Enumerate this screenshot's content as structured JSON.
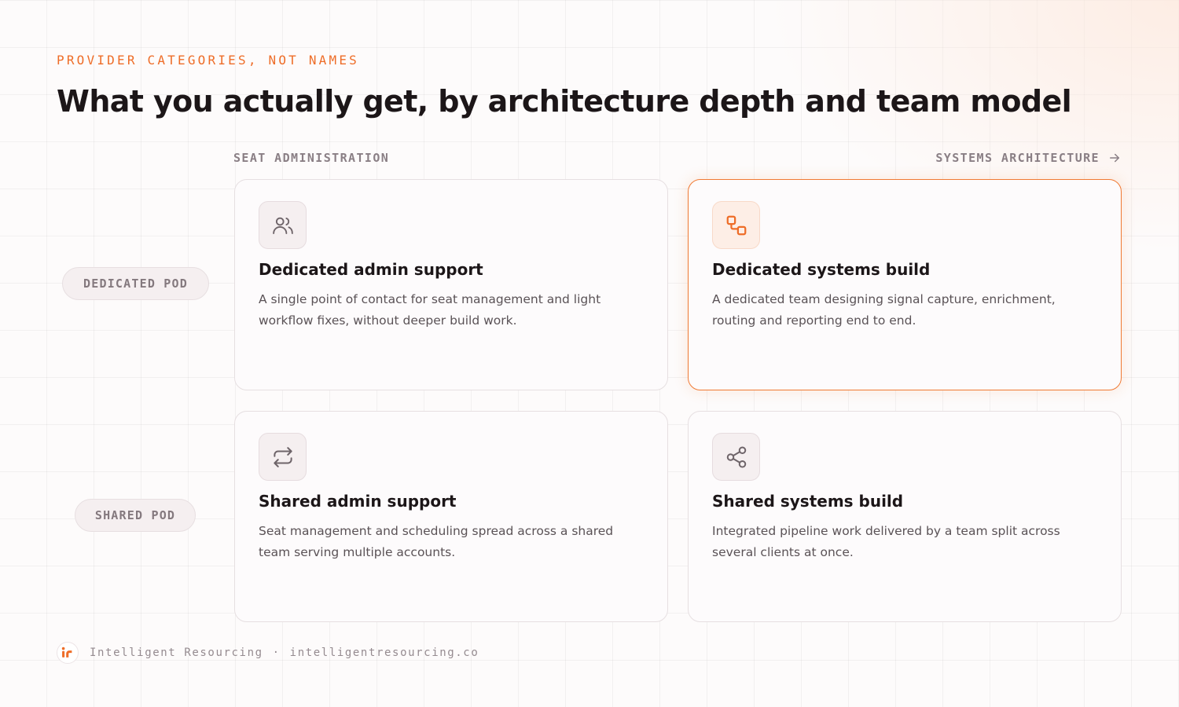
{
  "eyebrow": "PROVIDER CATEGORIES, NOT NAMES",
  "title": "What you actually get, by architecture depth and team model",
  "axis": {
    "left": "SEAT ADMINISTRATION",
    "right": "SYSTEMS ARCHITECTURE",
    "right_icon": "arrow-right-icon"
  },
  "rows": [
    {
      "label": "DEDICATED POD"
    },
    {
      "label": "SHARED POD"
    }
  ],
  "cards": [
    {
      "title": "Dedicated admin support",
      "description": "A single point of contact for seat management and light workflow fixes, without deeper build work.",
      "icon": "users-icon",
      "highlighted": false
    },
    {
      "title": "Dedicated systems build",
      "description": "A dedicated team designing signal capture, enrichment, routing and reporting end to end.",
      "icon": "workflow-icon",
      "highlighted": true
    },
    {
      "title": "Shared admin support",
      "description": "Seat management and scheduling spread across a shared team serving multiple accounts.",
      "icon": "repeat-icon",
      "highlighted": false
    },
    {
      "title": "Shared systems build",
      "description": "Integrated pipeline work delivered by a team split across several clients at once.",
      "icon": "share-icon",
      "highlighted": false
    }
  ],
  "footer": {
    "brand": "Intelligent Resourcing",
    "separator": "·",
    "url": "intelligentresourcing.co",
    "logo_icon": "ir-logo-icon"
  },
  "colors": {
    "accent": "#ee6d28",
    "text": "#1c1618",
    "muted": "#8a7f85",
    "card_border": "#e6dfe1",
    "background": "#fdfbfb"
  }
}
